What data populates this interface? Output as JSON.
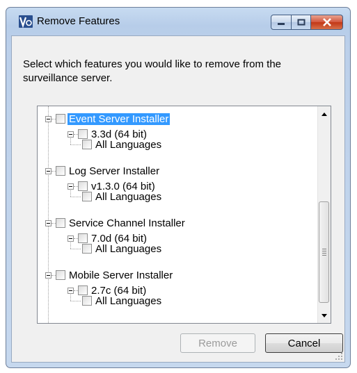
{
  "window": {
    "title": "Remove Features",
    "app_icon": "v-logo-icon",
    "controls": [
      "minimize-icon",
      "maximize-icon",
      "close-icon"
    ]
  },
  "prompt_text": "Select which features you would like to remove from the surveillance server.",
  "tree": {
    "items": [
      {
        "label": "Event Server Installer",
        "checked": false,
        "selected": true,
        "child": {
          "label": "3.3d (64 bit)",
          "checked": false,
          "child": {
            "label": "All Languages",
            "checked": false
          }
        }
      },
      {
        "label": "Log Server Installer",
        "checked": false,
        "selected": false,
        "child": {
          "label": "v1.3.0 (64 bit)",
          "checked": false,
          "child": {
            "label": "All Languages",
            "checked": false
          }
        }
      },
      {
        "label": "Service Channel Installer",
        "checked": false,
        "selected": false,
        "child": {
          "label": "7.0d (64 bit)",
          "checked": false,
          "child": {
            "label": "All Languages",
            "checked": false
          }
        }
      },
      {
        "label": "Mobile Server Installer",
        "checked": false,
        "selected": false,
        "child": {
          "label": "2.7c (64 bit)",
          "checked": false,
          "child": {
            "label": "All Languages",
            "checked": false
          }
        }
      }
    ]
  },
  "buttons": {
    "remove_label": "Remove",
    "remove_enabled": false,
    "cancel_label": "Cancel"
  },
  "colors": {
    "selection": "#3399ff",
    "close_button": "#c23716"
  }
}
